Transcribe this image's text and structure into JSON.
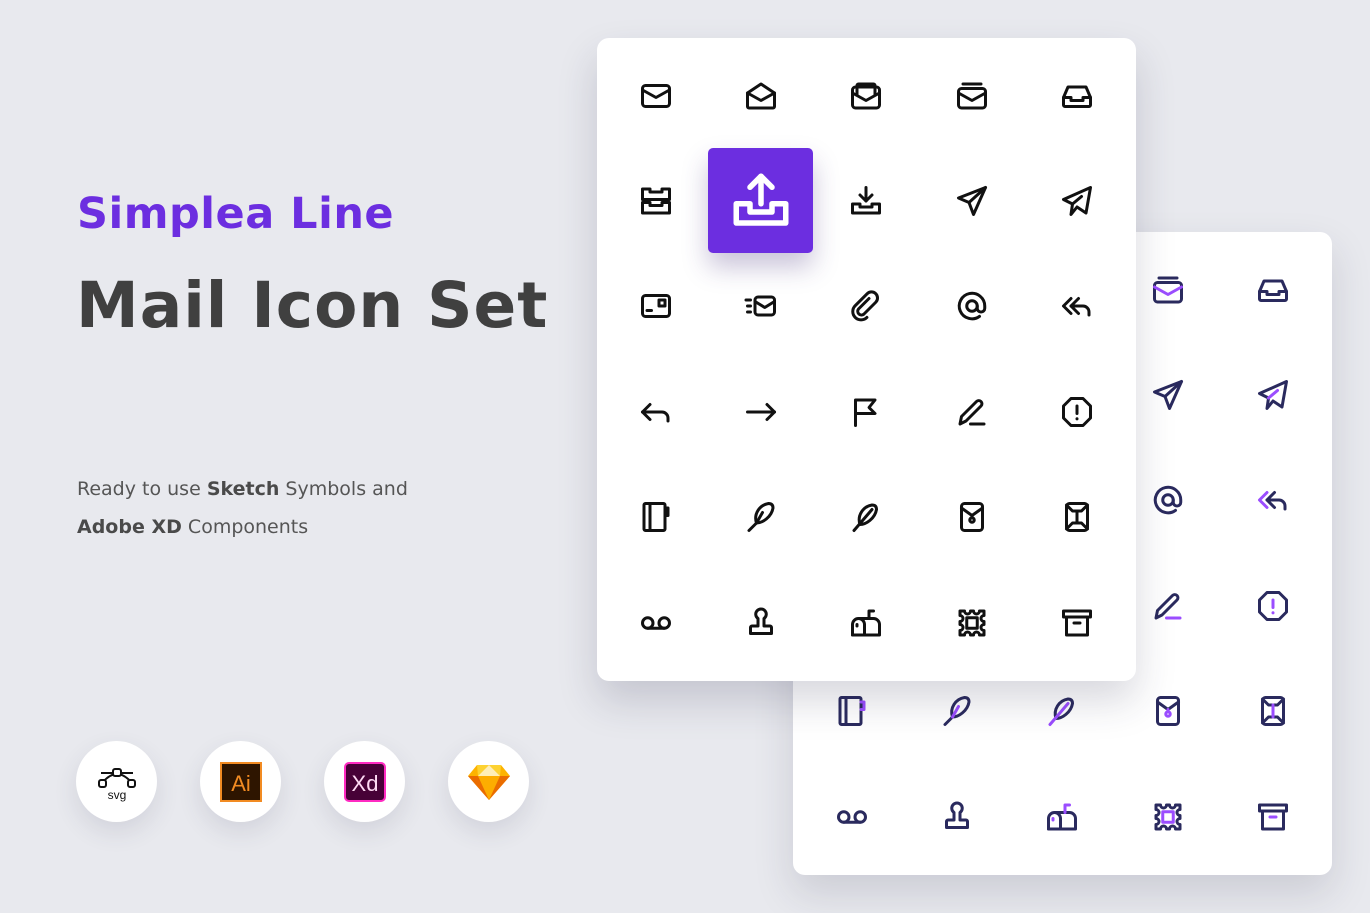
{
  "hero": {
    "subtitle": "Simplea Line",
    "title": "Mail Icon Set",
    "description": {
      "line1_prefix": "Ready to use ",
      "line1_bold": "Sketch",
      "line1_suffix": " Symbols and",
      "line2_bold": "Adobe XD",
      "line2_suffix": " Components"
    }
  },
  "colors": {
    "accent": "#6c2ee0",
    "heading": "#404040",
    "icon_front": "#111111",
    "icon_back": "#2a2a5e",
    "icon_back_accent": "#9b4dff",
    "background": "#e8e9ee"
  },
  "tools": [
    {
      "name": "svg",
      "label": "svg",
      "icon": "vector-pen-icon"
    },
    {
      "name": "illustrator",
      "label": "Ai",
      "icon": "adobe-illustrator-icon"
    },
    {
      "name": "xd",
      "label": "Xd",
      "icon": "adobe-xd-icon"
    },
    {
      "name": "sketch",
      "label": "",
      "icon": "sketch-diamond-icon"
    }
  ],
  "front_grid": {
    "active_index": 6,
    "icons": [
      "mail-icon",
      "mail-open-icon",
      "mail-letter-icon",
      "mail-stack-icon",
      "inbox-icon",
      "inbox-stack-icon",
      "inbox-upload-icon",
      "inbox-download-icon",
      "send-icon",
      "send-alt-icon",
      "id-card-icon",
      "mail-fast-icon",
      "attachment-icon",
      "at-sign-icon",
      "reply-all-icon",
      "reply-icon",
      "forward-icon",
      "flag-icon",
      "edit-icon",
      "alert-octagon-icon",
      "notebook-icon",
      "feather-icon",
      "feather-alt-icon",
      "envelope-seal-icon",
      "envelope-tie-icon",
      "voicemail-icon",
      "stamp-icon",
      "mailbox-icon",
      "postage-stamp-icon",
      "archive-icon"
    ]
  },
  "back_grid": {
    "icons": [
      "",
      "",
      "",
      "mail-stack-icon",
      "inbox-icon",
      "",
      "",
      "",
      "send-icon",
      "send-alt-icon",
      "",
      "",
      "",
      "at-sign-icon",
      "reply-all-icon",
      "",
      "",
      "",
      "edit-icon",
      "alert-octagon-icon",
      "notebook-icon",
      "feather-icon",
      "feather-alt-icon",
      "envelope-seal-icon",
      "envelope-tie-icon",
      "voicemail-icon",
      "stamp-icon",
      "mailbox-icon",
      "postage-stamp-icon",
      "archive-icon"
    ]
  }
}
